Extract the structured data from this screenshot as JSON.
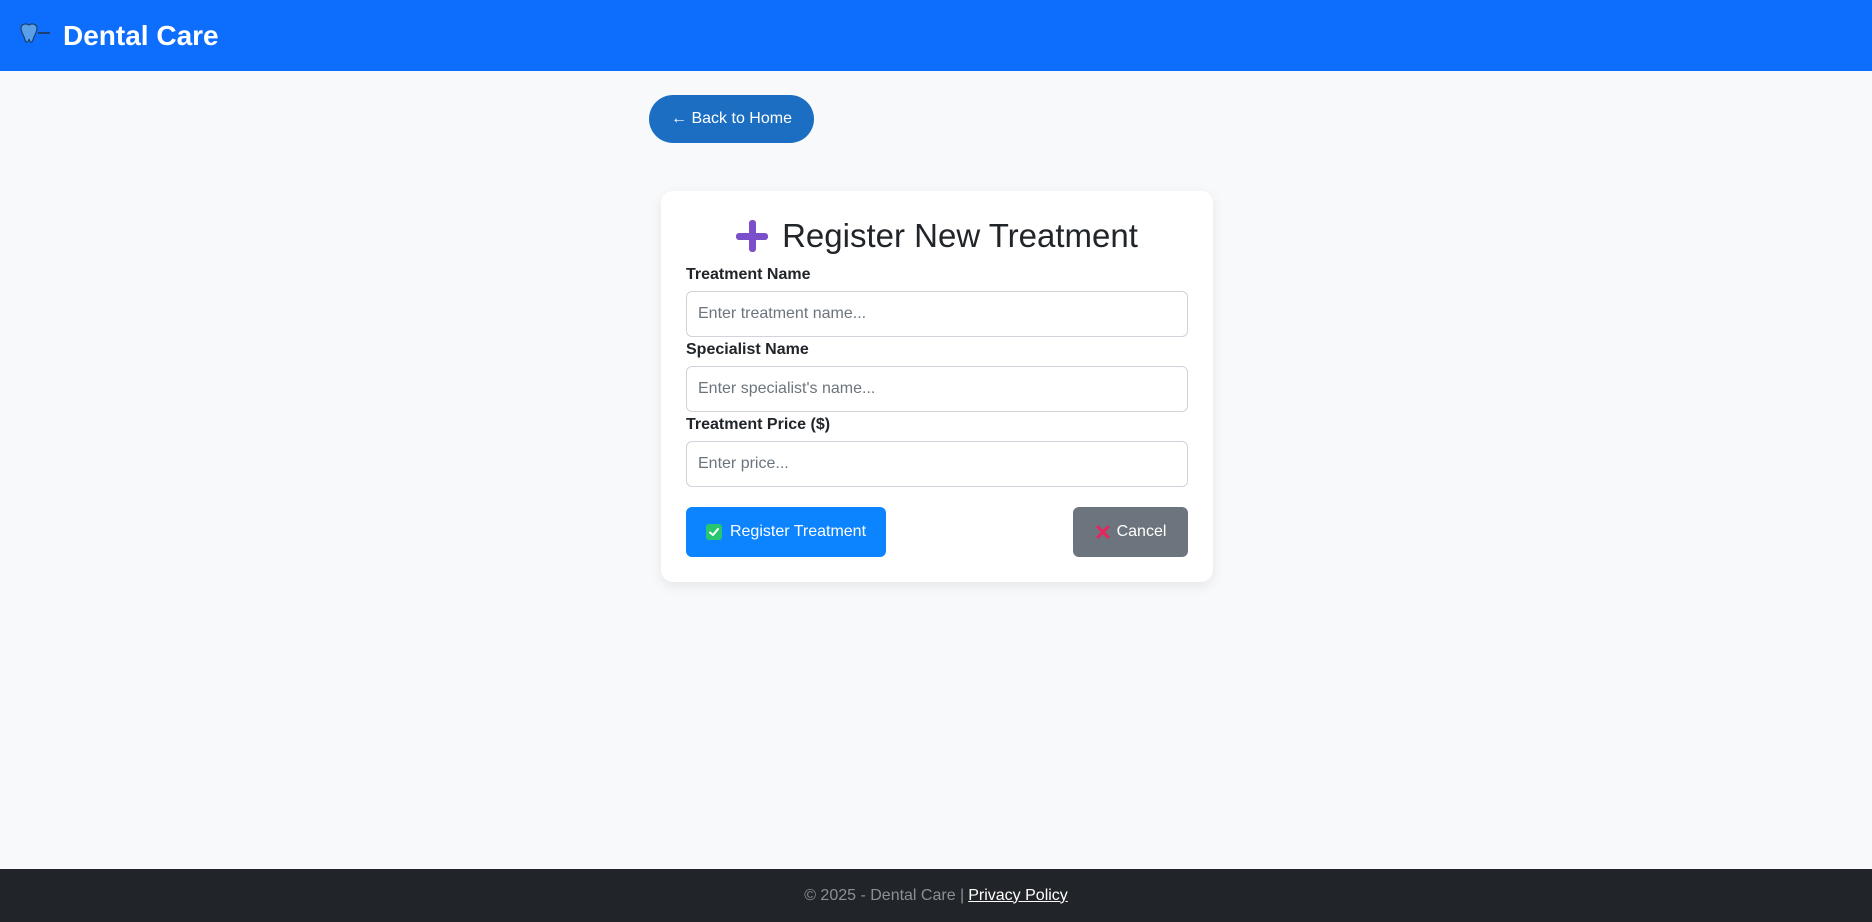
{
  "navbar": {
    "brand_icon": "tooth-logo-icon",
    "brand_text": "Dental Care",
    "bg_color": "#0d6efd"
  },
  "back_button": {
    "label": "← Back to Home"
  },
  "form": {
    "title": "Register New Treatment",
    "title_icon": "plus-icon",
    "fields": [
      {
        "label": "Treatment Name",
        "placeholder": "Enter treatment name...",
        "value": ""
      },
      {
        "label": "Specialist Name",
        "placeholder": "Enter specialist's name...",
        "value": ""
      },
      {
        "label": "Treatment Price ($)",
        "placeholder": "Enter price...",
        "value": ""
      }
    ],
    "submit_label": "Register Treatment",
    "submit_icon": "check-box-icon",
    "cancel_label": "Cancel",
    "cancel_icon": "cross-icon"
  },
  "footer": {
    "text": "© 2025 - Dental Care |",
    "link_label": "Privacy Policy"
  }
}
